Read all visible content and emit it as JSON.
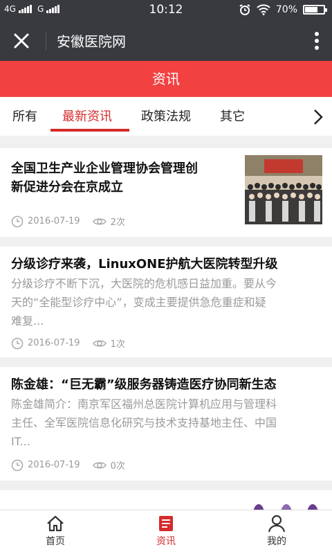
{
  "status": {
    "net1": "4G",
    "net2": "G",
    "time": "10:12",
    "battery": "70%",
    "battery_level": 0.7
  },
  "header": {
    "title": "安徽医院网",
    "close_icon": "close-icon",
    "more_icon": "more-vertical-icon"
  },
  "section": {
    "title": "资讯"
  },
  "tabs": [
    {
      "label": "所有"
    },
    {
      "label": "最新资讯"
    },
    {
      "label": "政策法规"
    },
    {
      "label": "其它"
    }
  ],
  "articles": [
    {
      "title_line1": "全国卫生产业企业管理协会管理创",
      "title_line2": "新促进分会在京成立",
      "date": "2016-07-19",
      "views": "2次"
    },
    {
      "title": "分级诊疗来袭，LinuxONE护航大医院转型升级",
      "summary_line1": "分级诊疗不断下沉，大医院的危机感日益加重。要从今",
      "summary_line2": "天的“全能型诊疗中心”，变成主要提供急危重症和疑",
      "summary_line3": "难复...",
      "date": "2016-07-19",
      "views": "1次"
    },
    {
      "title": "陈金雄：“巨无霸”级服务器铸造医疗协同新生态",
      "summary_line1": "陈金雄简介：南京军区福州总医院计算机应用与管理科",
      "summary_line2": "主任、全军医院信息化研究与技术支持基地主任、中国",
      "summary_line3": "IT...",
      "date": "2016-07-19",
      "views": "0次"
    }
  ],
  "bottom_nav": [
    {
      "label": "首页",
      "icon": "home-icon"
    },
    {
      "label": "资讯",
      "icon": "news-icon"
    },
    {
      "label": "我的",
      "icon": "user-icon"
    }
  ],
  "colors": {
    "header_bg": "#393a3f",
    "accent_red": "#f24141",
    "active_red": "#d62b2b"
  }
}
